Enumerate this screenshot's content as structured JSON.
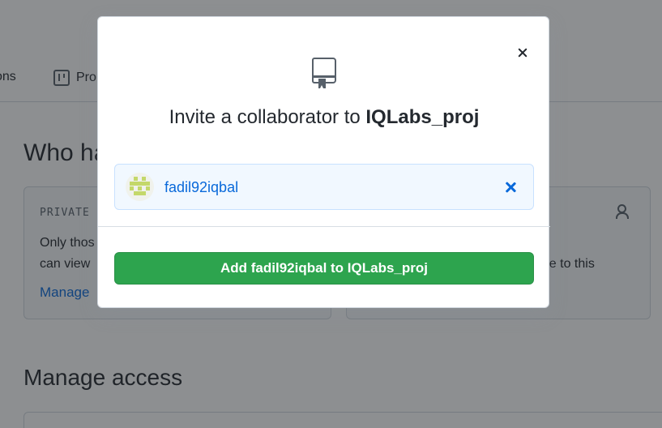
{
  "background": {
    "tabs": [
      {
        "label": "ons"
      },
      {
        "label": "Pro"
      }
    ],
    "heading": "Who ha",
    "private_card": {
      "label": "PRIVATE R",
      "text": "Only thos\ncan view",
      "link": "Manage"
    },
    "access_card": {
      "text": "this\nibute to this"
    },
    "manage_heading": "Manage access"
  },
  "dialog": {
    "title_prefix": "Invite a collaborator to ",
    "repo_name": "IQLabs_proj",
    "selected_user": {
      "username": "fadil92iqbal",
      "avatar_color": "#c4d86a"
    },
    "add_button_label": "Add fadil92iqbal to IQLabs_proj",
    "close_icon": "close-icon",
    "repo_icon": "repo-icon"
  },
  "colors": {
    "primary_button": "#2da44e",
    "link": "#0969da",
    "selection_bg": "#f1f8ff"
  }
}
